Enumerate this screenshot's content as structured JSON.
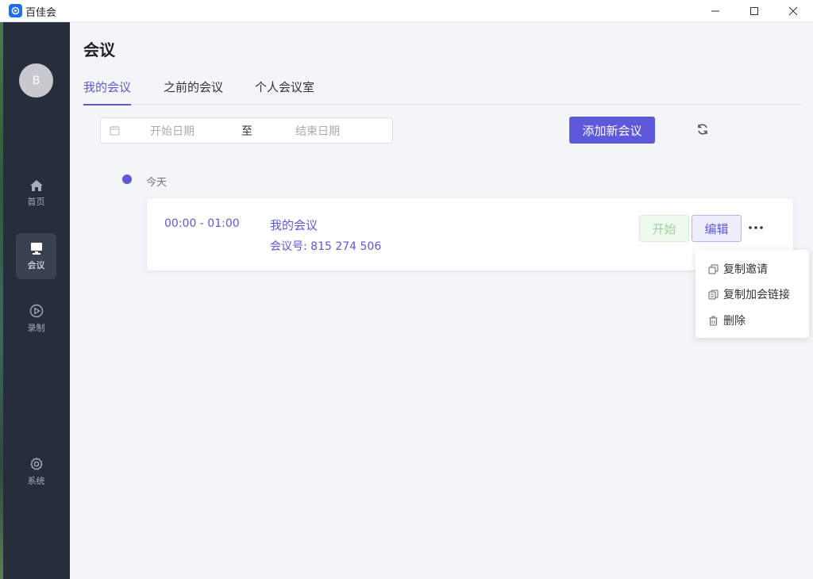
{
  "window": {
    "title": "百佳会"
  },
  "sidebar": {
    "avatar_initial": "B",
    "items": [
      {
        "label": "首页",
        "icon": "home-icon"
      },
      {
        "label": "会议",
        "icon": "monitor-icon"
      },
      {
        "label": "录制",
        "icon": "play-circle-icon"
      },
      {
        "label": "系统",
        "icon": "gear-icon"
      }
    ],
    "active_item": "会议"
  },
  "main": {
    "title": "会议",
    "tabs": [
      {
        "label": "我的会议"
      },
      {
        "label": "之前的会议"
      },
      {
        "label": "个人会议室"
      }
    ],
    "active_tab": "我的会议",
    "date_range": {
      "start_placeholder": "开始日期",
      "separator": "至",
      "end_placeholder": "结束日期"
    },
    "add_button_label": "添加新会议",
    "day_label": "今天",
    "meeting": {
      "time": "00:00 - 01:00",
      "name": "我的会议",
      "meeting_id": "会议号: 815 274 506",
      "start_label": "开始",
      "edit_label": "编辑"
    },
    "more_menu": [
      {
        "label": "复制邀请",
        "icon": "copy-icon"
      },
      {
        "label": "复制加会链接",
        "icon": "copy-link-icon"
      },
      {
        "label": "删除",
        "icon": "trash-icon"
      }
    ]
  },
  "colors": {
    "accent": "#5e58db",
    "sidebar_bg": "#262d3b",
    "start_button_text": "#9bd39b",
    "page_bg": "#f4f5f9"
  }
}
